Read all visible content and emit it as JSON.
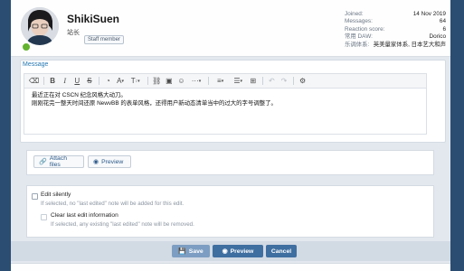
{
  "user": {
    "name": "ShikiSuen",
    "title": "站长",
    "badge": "Staff member"
  },
  "stats": [
    {
      "label": "Joined:",
      "value": "14 Nov 2019"
    },
    {
      "label": "Messages:",
      "value": "64"
    },
    {
      "label": "Reaction score:",
      "value": "6"
    },
    {
      "label": "常用 DAW:",
      "value": "Dorico"
    },
    {
      "label": "乐调体系:",
      "value": "英美量家体系, 日本艺大和声"
    }
  ],
  "editor": {
    "label": "Message",
    "lines": [
      "最近正在对 CSCN 纪念风格大动刀。",
      "刚刚花完一整天时间还原 NewvBB 的表单风格，还得用户新动态清单当中的过大的字号调整了。"
    ],
    "toolbar_icons": [
      "eraser-icon",
      "bold-icon",
      "italic-icon",
      "underline-icon",
      "strikethrough-icon",
      "text-color-icon",
      "font-family-icon",
      "font-size-icon",
      "link-icon",
      "image-icon",
      "smilies-icon",
      "more-icon",
      "align-icon",
      "list-icon",
      "table-icon",
      "undo-icon",
      "redo-icon",
      "bbcode-icon"
    ]
  },
  "attach": {
    "attach_label": "Attach files",
    "preview_label": "Preview"
  },
  "options": {
    "edit_silently": "Edit silently",
    "edit_silently_hint": "If selected, no \"last edited\" note will be added for this edit.",
    "clear_last_edit": "Clear last edit information",
    "clear_last_edit_hint": "If selected, any existing \"last edited\" note will be removed."
  },
  "actions": {
    "save_label": "Save",
    "preview_label": "Preview",
    "cancel_label": "Cancel"
  },
  "colors": {
    "accent": "#3f6fa1",
    "background": "#2b4d72",
    "online": "#63b32e"
  }
}
